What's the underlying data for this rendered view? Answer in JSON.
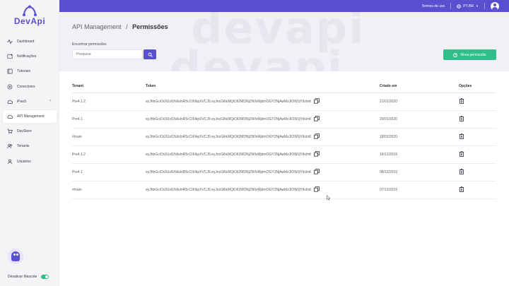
{
  "sidebar": {
    "logo_text": "DevApi",
    "items": [
      {
        "label": "Dashboard",
        "icon": "pulse-icon",
        "active": false
      },
      {
        "label": "Notificações",
        "icon": "notification-icon",
        "active": false
      },
      {
        "label": "Tutoriais",
        "icon": "book-icon",
        "active": false
      },
      {
        "label": "Conectores",
        "icon": "connector-icon",
        "active": false
      },
      {
        "label": "iPaaS",
        "icon": "cloud-upload-icon",
        "active": false,
        "has_chevron": true
      },
      {
        "label": "API Management",
        "icon": "cloud-icon",
        "active": true
      },
      {
        "label": "DevStore",
        "icon": "cart-icon",
        "active": false
      },
      {
        "label": "Tenants",
        "icon": "users-icon",
        "active": false
      },
      {
        "label": "Usuários",
        "icon": "user-icon",
        "active": false
      }
    ],
    "mascot_toggle_label": "Desativar Mascote",
    "mascot_enabled": true
  },
  "topbar": {
    "terms_label": "Termos de uso",
    "language_label": "PT-BR"
  },
  "header": {
    "watermark": "devapi",
    "breadcrumb_parent": "API Management",
    "breadcrumb_separator": "/",
    "breadcrumb_current": "Permissões",
    "search_label": "Encontrar permissões",
    "search_placeholder": "Pesquisa",
    "new_button_label": "Nova permissão"
  },
  "table": {
    "columns": {
      "tenant": "Tenant",
      "token": "Token",
      "created": "Criado em",
      "options": "Opções"
    },
    "rows": [
      {
        "tenant": "Pre4.1.2",
        "token": "eyJhbGciOiJIUzI1NiIsInR5cCI6IkpXVCJ9.eyJncGlfaWQiOiI2MDNjZWIxMjdmOGY2NjAwMzJlOWJjYiIsImlhdCI6MTYw",
        "created": "21/01/2020"
      },
      {
        "tenant": "Pre4.1",
        "token": "eyJhbGciOiJIUzI1NiIsInR5cCI6IkpXVCJ9.eyJncGlfaWQiOiI2MDNjZWIxMjdmOGY2NjAwMzJlOWJjYiIsImlhdCI6MTYw",
        "created": "20/01/2020"
      },
      {
        "tenant": "#main",
        "token": "eyJhbGciOiJIUzI1NiIsInR5cCI6IkpXVCJ9.eyJncGlfaWQiOiI2MDNjZWIxMjdmOGY2NjAwMzJlOWJjYiIsImlhdCI6MTYw",
        "created": "18/01/2020"
      },
      {
        "tenant": "Pre4.1.2",
        "token": "eyJhbGciOiJIUzI1NiIsInR5cCI6IkpXVCJ9.eyJncGlfaWQiOiI2MDNjZWIxMjdmOGY2NjAwMzJlOWJjYiIsImlhdCI6MTYw",
        "created": "10/12/2019"
      },
      {
        "tenant": "Pre4.1",
        "token": "eyJhbGciOiJIUzI1NiIsInR5cCI6IkpXVCJ9.eyJncGlfaWQiOiI2MDNjZWIxMjdmOGY2NjAwMzJlOWJjYiIsImlhdCI6MTYw",
        "created": "08/12/2019"
      },
      {
        "tenant": "#main",
        "token": "eyJhbGciOiJIUzI1NiIsInR5cCI6IkpXVCJ9.eyJncGlfaWQiOiI2MDNjZWIxMjdmOGY2NjAwMzJlOWJjYiIsImlhdCI6MTYw",
        "created": "07/12/2019"
      }
    ]
  },
  "colors": {
    "brand": "#5a4fcf",
    "success": "#2fbf8a",
    "sidebar_bg": "#f4f4f6",
    "header_bg": "#f1f1f5"
  }
}
